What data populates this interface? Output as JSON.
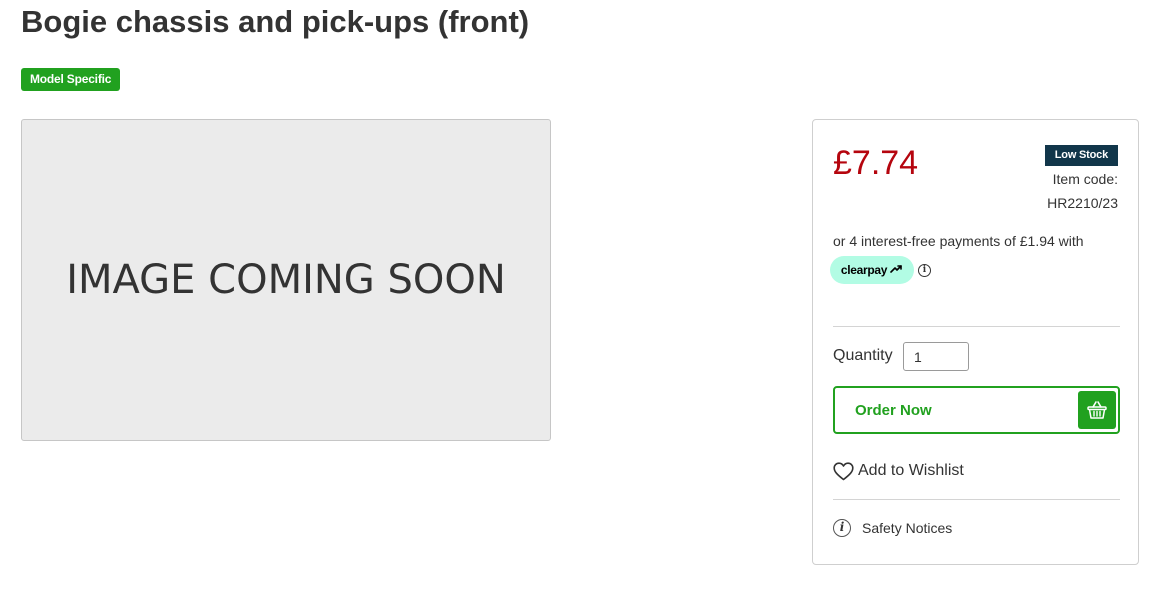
{
  "product": {
    "title": "Bogie chassis and pick-ups (front)",
    "badge": "Model Specific",
    "image_placeholder": "IMAGE COMING SOON"
  },
  "purchase": {
    "price": "£7.74",
    "stock_status": "Low Stock",
    "item_code_label": "Item code:",
    "item_code": "HR2210/23",
    "clearpay_text": "or 4 interest-free payments of £1.94 with",
    "clearpay_logo": "clearpay",
    "clearpay_info": "i",
    "quantity_label": "Quantity",
    "quantity_value": "1",
    "order_label": "Order Now",
    "wishlist_label": "Add to Wishlist",
    "safety_icon_glyph": "i",
    "safety_label": "Safety Notices"
  },
  "colors": {
    "price": "#b5050e",
    "accent_green": "#21a11f",
    "stock_badge": "#11364a",
    "clearpay_mint": "#b2fce4"
  },
  "icons": {
    "basket": "basket-icon",
    "heart": "heart-icon",
    "info": "info-icon",
    "clearpay_arrows": "clearpay-arrows-icon"
  }
}
